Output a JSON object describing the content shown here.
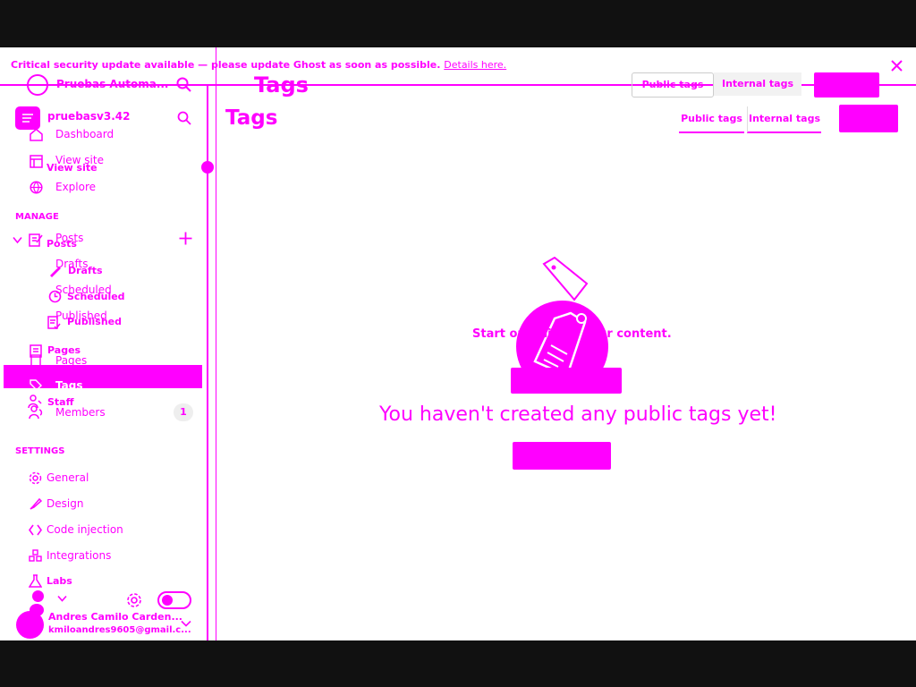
{
  "banner": {
    "text": "Critical security update available — please update Ghost as soon as possible.",
    "link": "Details here."
  },
  "sidebar_ghost": {
    "site_title": "Pruebas Automa...",
    "links": [
      "View site",
      "Posts",
      "Drafts",
      "Scheduled",
      "Published",
      "Pages",
      "Staff"
    ]
  },
  "sidebar": {
    "site_title": "pruebasv3.42",
    "nav": {
      "dashboard": "Dashboard",
      "view_site": "View site",
      "explore": "Explore"
    },
    "manage_heading": "MANAGE",
    "manage": {
      "posts": "Posts",
      "drafts": "Drafts",
      "scheduled": "Scheduled",
      "published": "Published",
      "pages": "Pages",
      "tags": "Tags",
      "members": "Members",
      "members_count": "1"
    },
    "settings_heading": "SETTINGS",
    "settings": {
      "general": "General",
      "design": "Design",
      "code_injection": "Code injection",
      "integrations": "Integrations",
      "labs": "Labs"
    },
    "user": {
      "name": "Andres Camilo Carden...",
      "email": "kmiloandres9605@gmail.c..."
    }
  },
  "ghost_header": {
    "title": "Tags",
    "tab_public": "Public tags",
    "tab_internal": "Internal tags"
  },
  "header": {
    "title": "Tags",
    "tab_public": "Public tags",
    "tab_internal": "Internal tags"
  },
  "empty_state": {
    "ghost_text": "Start organizing your content.",
    "message": "You haven't created any public tags yet!"
  },
  "colors": {
    "accent": "#ff00ff",
    "background": "#ffffff",
    "frame": "#111111"
  }
}
